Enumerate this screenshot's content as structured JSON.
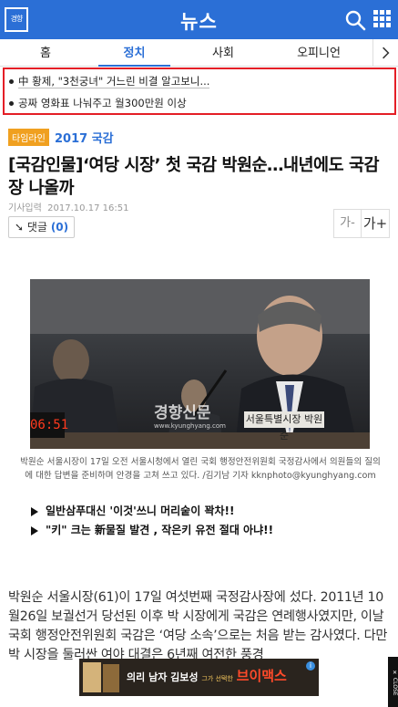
{
  "header": {
    "logo_text": "경향",
    "title": "뉴스"
  },
  "nav": {
    "tabs": [
      {
        "label": "홈"
      },
      {
        "label": "정치",
        "active": true
      },
      {
        "label": "사회"
      },
      {
        "label": "오피니언"
      }
    ]
  },
  "headlines": [
    {
      "text": "中 황제, \"3천궁녀\" 거느린 비결 알고보니..."
    },
    {
      "text": "공짜 영화표 나눠주고 월300만원 이상"
    }
  ],
  "article": {
    "badge": "타임라인",
    "topic": "2017 국감",
    "title": "[국감인물]‘여당 시장’ 첫 국감 박원순…내년에도 국감장 나올까",
    "timestamp_label": "기사입력",
    "timestamp": "2017.10.17 16:51",
    "comment_label": "댓글",
    "comment_count": "(0)",
    "font_smaller": "가-",
    "font_larger": "가+",
    "photo": {
      "watermark": "경향신문",
      "watermark_sub": "www.kyunghyang.com",
      "timer": "06:51",
      "nameplate": "서울특별시장 박원순"
    },
    "caption": "박원순 서울시장이 17일 오전 서울시청에서 열린 국회 행정안전위원회 국정감사에서 의원들의 질의에 대한 답변을 준비하며 안경을 고쳐 쓰고 있다. /김기남 기자 kknphoto@kyunghyang.com",
    "promos": [
      {
        "text": "일반삼푸대신 '이것'쓰니 머리숱이 꽉차!!"
      },
      {
        "text": "\"키\" 크는 新물질 발견 , 작은키 유전 절대 아냐!!"
      }
    ],
    "body": "박원순 서울시장(61)이 17일 여섯번째 국정감사장에 섰다. 2011년 10월26일 보궐선거 당선된 이후 박 시장에게 국감은 연례행사였지만, 이날 국회 행정안전위원회 국감은 ‘여당 소속’으로는 처음 받는 감사였다. 다만 박 시장을 둘러싼 여야 대결은 6년째 여전한 풍경"
  },
  "ad": {
    "text_1": "의리",
    "text_2": "남자 김보성",
    "sub": "그가 선택한",
    "brand": "브이맥스",
    "close": "CLOSE"
  },
  "colors": {
    "brand_blue": "#2b6fd6",
    "headline_box_border": "#e41e26",
    "badge_orange": "#f0a020"
  }
}
